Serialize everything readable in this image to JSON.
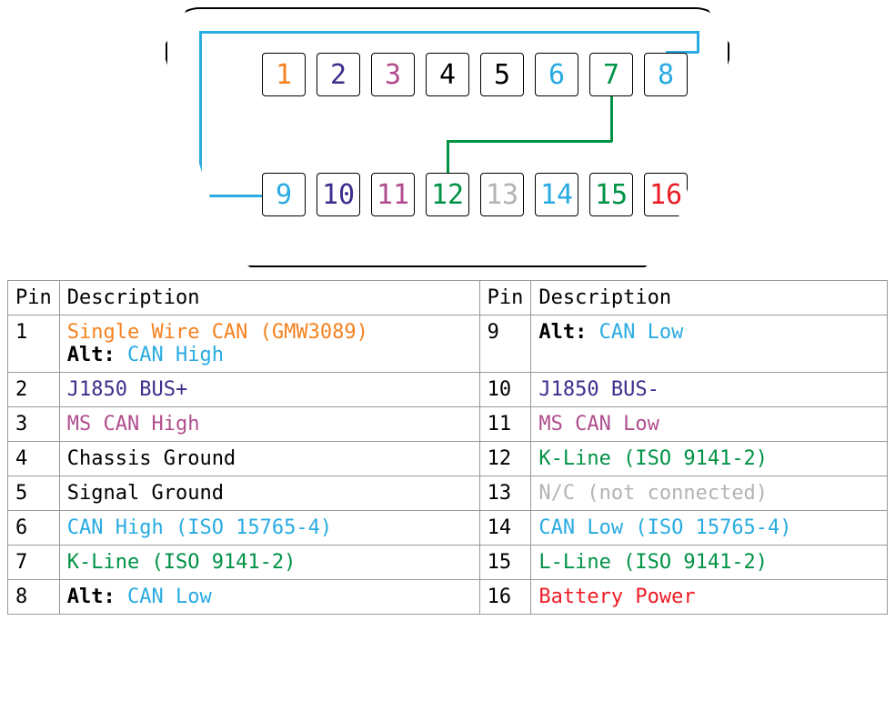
{
  "colors": {
    "orange": "#f58220",
    "indigo": "#3b2e8c",
    "magenta": "#b04d8e",
    "black": "#000000",
    "blue": "#29abe2",
    "green": "#009245",
    "grey": "#b3b3b3",
    "red": "#ed1c24"
  },
  "connector": {
    "pins_top": [
      1,
      2,
      3,
      4,
      5,
      6,
      7,
      8
    ],
    "pins_bottom": [
      9,
      10,
      11,
      12,
      13,
      14,
      15,
      16
    ],
    "pin_colors": {
      "1": "orange",
      "2": "indigo",
      "3": "magenta",
      "4": "black",
      "5": "black",
      "6": "blue",
      "7": "green",
      "8": "blue",
      "9": "blue",
      "10": "indigo",
      "11": "magenta",
      "12": "green",
      "13": "grey",
      "14": "blue",
      "15": "green",
      "16": "red"
    },
    "wires": [
      {
        "from": 8,
        "to": 9,
        "color": "blue"
      },
      {
        "from": 7,
        "to": 12,
        "color": "green"
      }
    ]
  },
  "table": {
    "headers": {
      "pin": "Pin",
      "desc": "Description"
    },
    "alt_label": "Alt:",
    "rows": [
      {
        "left": {
          "pin": 1,
          "desc": "Single Wire CAN (GMW3089)",
          "color": "orange",
          "alt_desc": "CAN High",
          "alt_color": "blue"
        },
        "right": {
          "pin": 9,
          "alt_desc": "CAN Low",
          "alt_color": "blue"
        }
      },
      {
        "left": {
          "pin": 2,
          "desc": "J1850 BUS+",
          "color": "indigo"
        },
        "right": {
          "pin": 10,
          "desc": "J1850 BUS-",
          "color": "indigo"
        }
      },
      {
        "left": {
          "pin": 3,
          "desc": "MS CAN High",
          "color": "magenta"
        },
        "right": {
          "pin": 11,
          "desc": "MS CAN Low",
          "color": "magenta"
        }
      },
      {
        "left": {
          "pin": 4,
          "desc": "Chassis Ground",
          "color": "black"
        },
        "right": {
          "pin": 12,
          "desc": "K-Line (ISO 9141-2)",
          "color": "green"
        }
      },
      {
        "left": {
          "pin": 5,
          "desc": "Signal Ground",
          "color": "black"
        },
        "right": {
          "pin": 13,
          "desc": "N/C (not connected)",
          "color": "grey"
        }
      },
      {
        "left": {
          "pin": 6,
          "desc": "CAN High (ISO 15765-4)",
          "color": "blue"
        },
        "right": {
          "pin": 14,
          "desc": "CAN Low (ISO 15765-4)",
          "color": "blue"
        }
      },
      {
        "left": {
          "pin": 7,
          "desc": "K-Line (ISO 9141-2)",
          "color": "green"
        },
        "right": {
          "pin": 15,
          "desc": "L-Line (ISO 9141-2)",
          "color": "green"
        }
      },
      {
        "left": {
          "pin": 8,
          "alt_desc": "CAN Low",
          "alt_color": "blue"
        },
        "right": {
          "pin": 16,
          "desc": "Battery Power",
          "color": "red"
        }
      }
    ]
  }
}
